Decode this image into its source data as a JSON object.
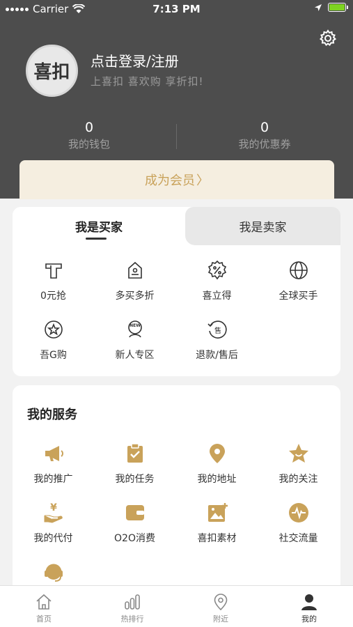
{
  "status_bar": {
    "carrier": "Carrier",
    "time": "7:13 PM"
  },
  "profile": {
    "avatar_logo_text": "喜扣",
    "login_title": "点击登录/注册",
    "login_subtitle": "上喜扣 喜欢购 享折扣!"
  },
  "stats": [
    {
      "value": "0",
      "label": "我的钱包"
    },
    {
      "value": "0",
      "label": "我的优惠券"
    }
  ],
  "member_banner": {
    "label": "成为会员",
    "arrow": "〉"
  },
  "role_tabs": {
    "buyer": "我是买家",
    "seller": "我是卖家",
    "selected": "buyer"
  },
  "buyer_items": [
    {
      "label": "0元抢",
      "icon": "zero-price-icon"
    },
    {
      "label": "多买多折",
      "icon": "shop-discount-icon"
    },
    {
      "label": "喜立得",
      "icon": "percent-badge-icon"
    },
    {
      "label": "全球买手",
      "icon": "globe-icon"
    },
    {
      "label": "吾G购",
      "icon": "star-circle-icon"
    },
    {
      "label": "新人专区",
      "icon": "new-user-icon"
    },
    {
      "label": "退款/售后",
      "icon": "refund-icon"
    }
  ],
  "services": {
    "title": "我的服务",
    "items": [
      {
        "label": "我的推广",
        "icon": "megaphone-icon"
      },
      {
        "label": "我的任务",
        "icon": "task-clipboard-icon"
      },
      {
        "label": "我的地址",
        "icon": "location-pin-icon"
      },
      {
        "label": "我的关注",
        "icon": "star-smile-icon"
      },
      {
        "label": "我的代付",
        "icon": "yen-hand-icon"
      },
      {
        "label": "O2O消费",
        "icon": "wallet-icon"
      },
      {
        "label": "喜扣素材",
        "icon": "image-add-icon"
      },
      {
        "label": "社交流量",
        "icon": "pulse-circle-icon"
      },
      {
        "label": "",
        "icon": "headset-icon"
      }
    ]
  },
  "tabbar": [
    {
      "label": "首页",
      "icon": "home-icon"
    },
    {
      "label": "热排行",
      "icon": "bar-chart-icon"
    },
    {
      "label": "附近",
      "icon": "nearby-pin-icon"
    },
    {
      "label": "我的",
      "icon": "person-icon",
      "active": true
    }
  ],
  "colors": {
    "header_bg": "#4d4d4d",
    "gold": "#c9a25a",
    "member_bg": "#f5eee0",
    "battery": "#7ed321"
  }
}
